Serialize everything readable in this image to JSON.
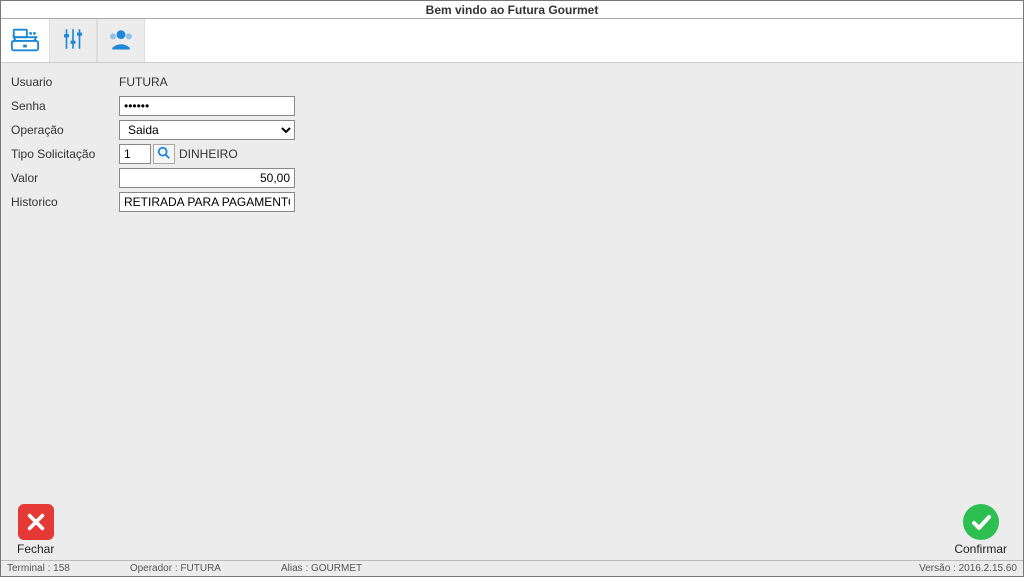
{
  "title": "Bem vindo ao Futura Gourmet",
  "toolbar": {
    "icons": [
      "cash-register",
      "sliders",
      "users"
    ]
  },
  "form": {
    "usuario_label": "Usuario",
    "usuario_value": "FUTURA",
    "senha_label": "Senha",
    "senha_value": "••••••",
    "operacao_label": "Operação",
    "operacao_value": "Saida",
    "tipo_label": "Tipo Solicitação",
    "tipo_code": "1",
    "tipo_text": "DINHEIRO",
    "valor_label": "Valor",
    "valor_value": "50,00",
    "historico_label": "Historico",
    "historico_value": "RETIRADA PARA PAGAMENTO"
  },
  "actions": {
    "close_label": "Fechar",
    "confirm_label": "Confirmar"
  },
  "status": {
    "terminal_label": "Terminal :",
    "terminal_value": "158",
    "operador_label": "Operador :",
    "operador_value": "FUTURA",
    "alias_label": "Alias :",
    "alias_value": "GOURMET",
    "versao_label": "Versão :",
    "versao_value": "2016.2.15.60"
  }
}
